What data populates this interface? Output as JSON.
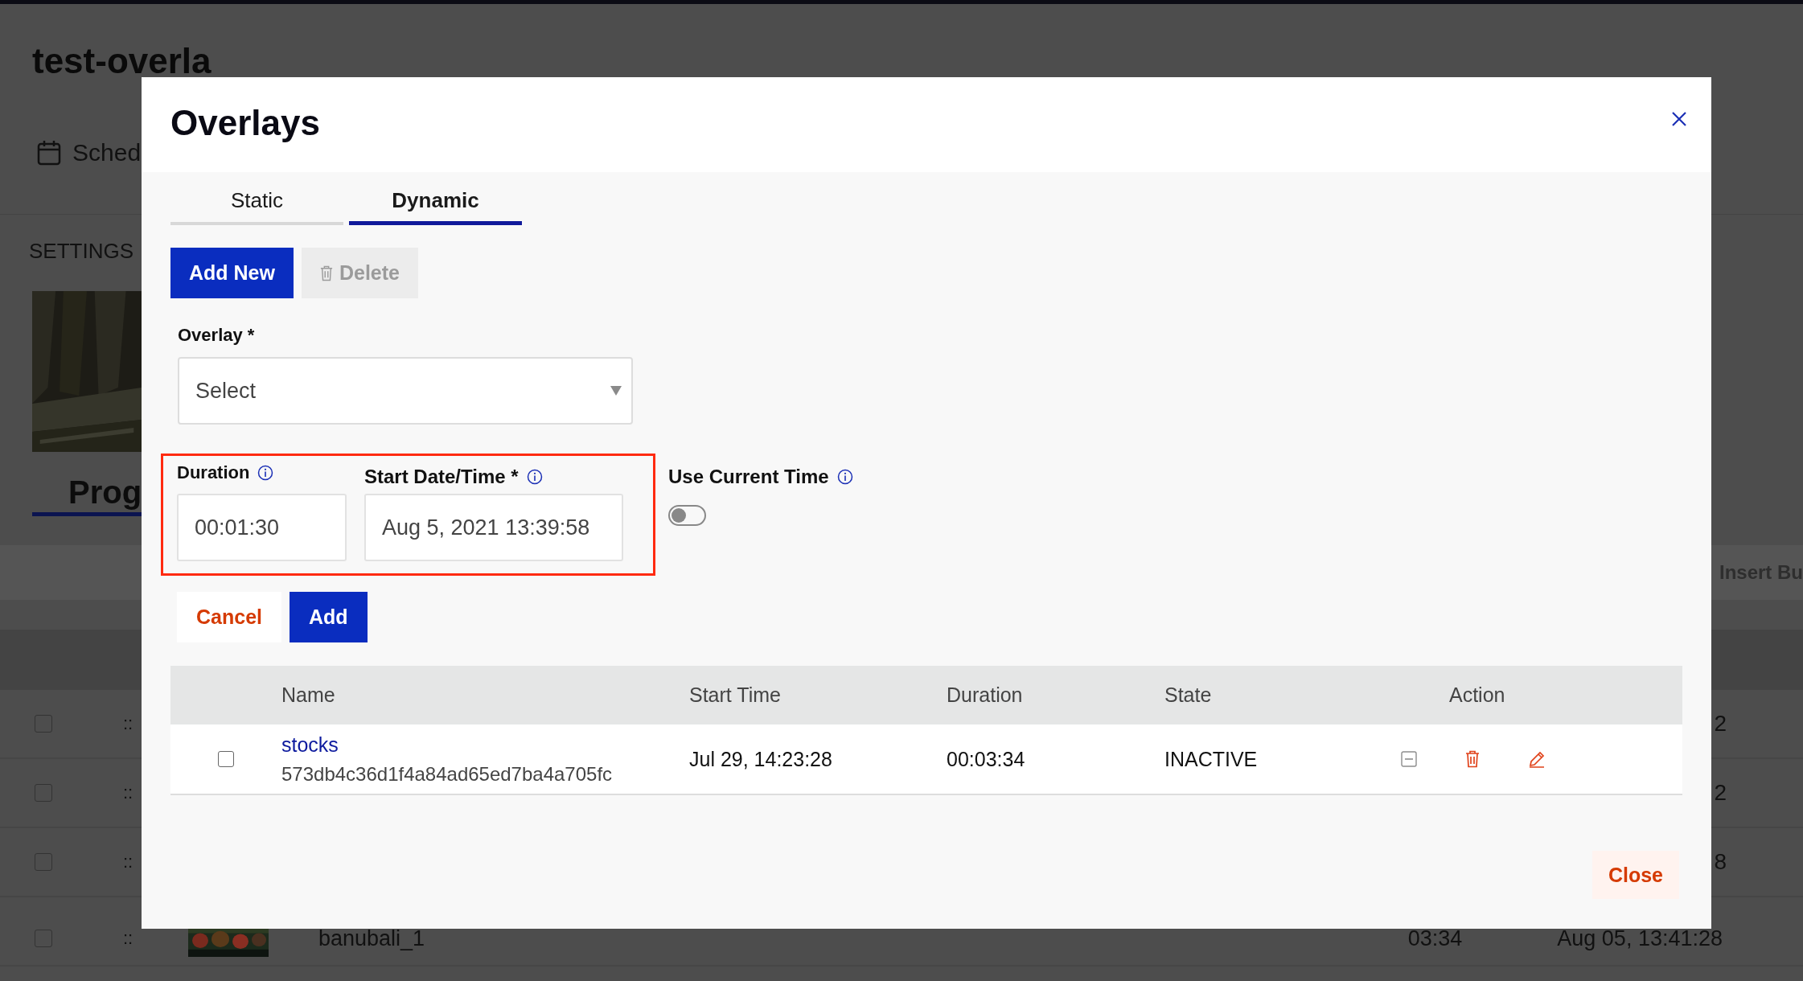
{
  "background_page": {
    "title": "test-overla",
    "schedule_tab": "Sched",
    "settings_label": "SETTINGS",
    "program_tab": "Prog",
    "insert_button": "Insert Bu",
    "rows": [
      {
        "kind": "covered",
        "checked": false,
        "handle": "::",
        "end_value": "2"
      },
      {
        "kind": "covered",
        "checked": false,
        "handle": "::",
        "end_value": "2"
      },
      {
        "kind": "covered",
        "checked": false,
        "handle": "::",
        "end_value": "8"
      },
      {
        "kind": "full",
        "checked": false,
        "handle": "::",
        "name": "banubali_1",
        "duration": "03:34",
        "start_time": "Aug 05, 13:41:28"
      }
    ]
  },
  "dialog": {
    "title": "Overlays",
    "tabs": [
      {
        "label": "Static",
        "selected": false
      },
      {
        "label": "Dynamic",
        "selected": true
      }
    ],
    "toolbar": [
      {
        "label": "Add New",
        "kind": "primary",
        "disabled": false
      },
      {
        "label": "Delete",
        "kind": "delete",
        "disabled": true
      }
    ],
    "overlay_field": {
      "label": "Overlay *",
      "value": "Select"
    },
    "highlighted": true,
    "duration_field": {
      "label": "Duration",
      "value": "00:01:30"
    },
    "start_field": {
      "label": "Start Date/Time *",
      "value": "Aug 5, 2021 13:39:58"
    },
    "use_current_time": {
      "label": "Use Current Time",
      "on": false
    },
    "form_buttons": [
      {
        "label": "Cancel",
        "kind": "secondary"
      },
      {
        "label": "Add",
        "kind": "primary"
      }
    ],
    "table": {
      "columns": [
        "Name",
        "Start Time",
        "Duration",
        "State",
        "Action"
      ],
      "rows": [
        {
          "checked": false,
          "name": "stocks",
          "id": "573db4c36d1f4a84ad65ed7ba4a705fc",
          "start_time": "Jul 29, 14:23:28",
          "duration": "00:03:34",
          "state": "INACTIVE"
        }
      ]
    },
    "footer_button": "Close"
  }
}
